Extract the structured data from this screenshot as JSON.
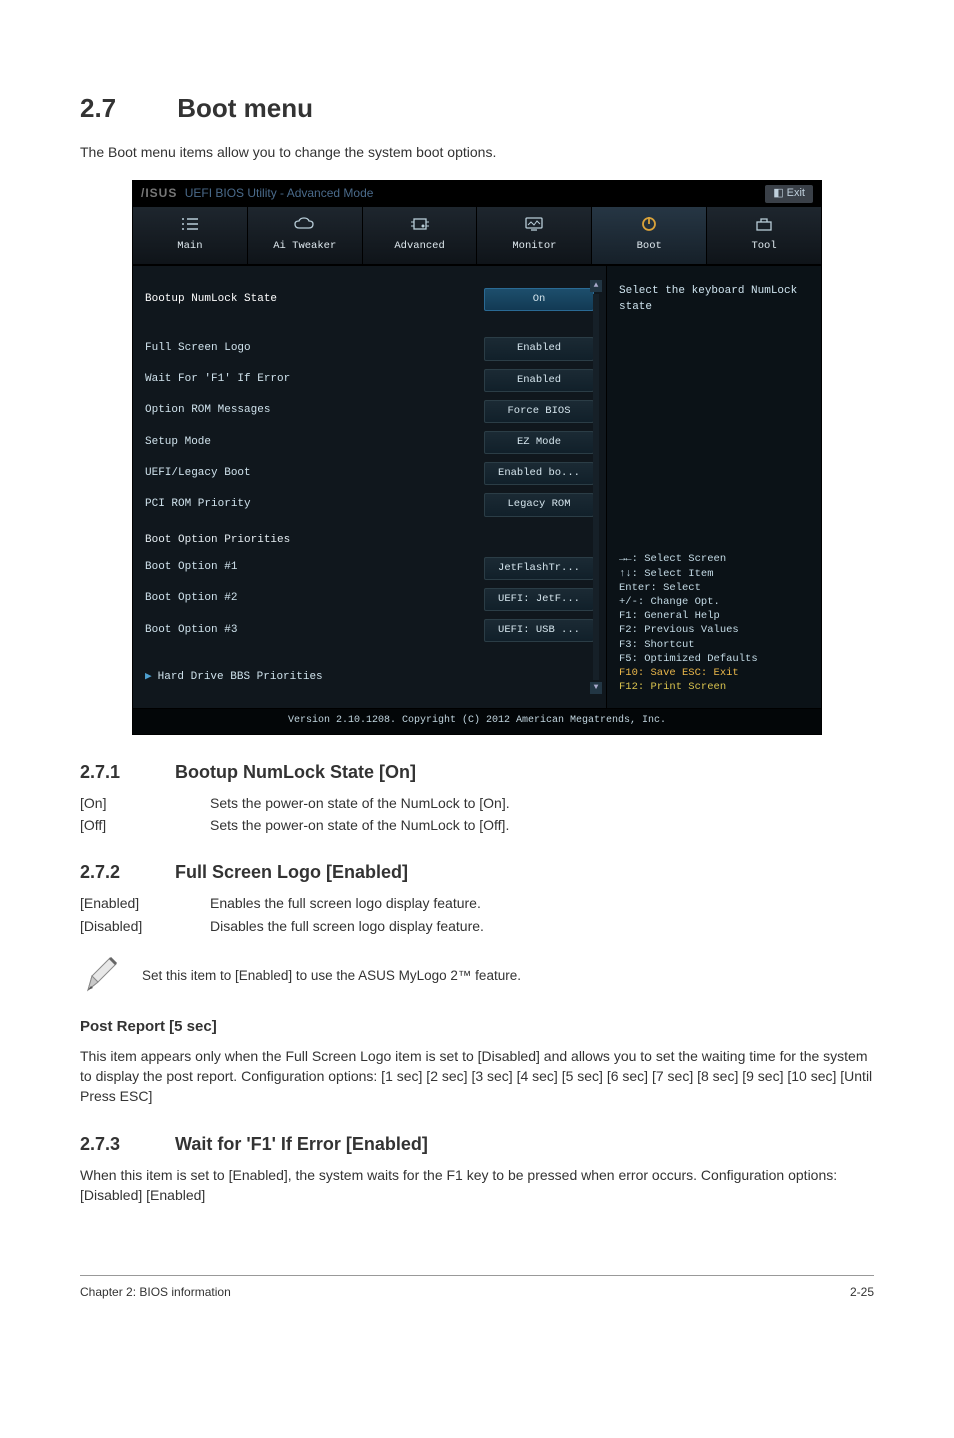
{
  "section27": {
    "num": "2.7",
    "title": "Boot menu"
  },
  "intro27": "The Boot menu items allow you to change the system boot options.",
  "bios": {
    "brand": "/ISUS",
    "titlebar": "UEFI BIOS Utility - Advanced Mode",
    "exit": "Exit",
    "tabs": {
      "main": "Main",
      "ai": "Ai Tweaker",
      "adv": "Advanced",
      "mon": "Monitor",
      "boot": "Boot",
      "tool": "Tool"
    },
    "fields": {
      "numlock": {
        "label": "Bootup NumLock State",
        "value": "On"
      },
      "logo": {
        "label": "Full Screen Logo",
        "value": "Enabled"
      },
      "waitf1": {
        "label": "Wait For 'F1' If Error",
        "value": "Enabled"
      },
      "oprom": {
        "label": "Option ROM Messages",
        "value": "Force BIOS"
      },
      "setup": {
        "label": "Setup Mode",
        "value": "EZ Mode"
      },
      "uefileg": {
        "label": "UEFI/Legacy Boot",
        "value": "Enabled bo..."
      },
      "pcirom": {
        "label": "PCI ROM Priority",
        "value": "Legacy ROM"
      }
    },
    "bootpri_title": "Boot Option Priorities",
    "bootopts": {
      "o1": {
        "label": "Boot Option #1",
        "value": "JetFlashTr..."
      },
      "o2": {
        "label": "Boot Option #2",
        "value": "UEFI: JetF..."
      },
      "o3": {
        "label": "Boot Option #3",
        "value": "UEFI: USB ..."
      }
    },
    "hdd_line": "Hard Drive BBS Priorities",
    "rhelp": "Select the keyboard NumLock state",
    "keys": {
      "l1": "→←: Select Screen",
      "l2": "↑↓: Select Item",
      "l3": "Enter: Select",
      "l4": "+/-: Change Opt.",
      "l5": "F1: General Help",
      "l6": "F2: Previous Values",
      "l7": "F3: Shortcut",
      "l8": "F5: Optimized Defaults",
      "l9": "F10: Save  ESC: Exit",
      "l10": "F12: Print Screen"
    },
    "footer": "Version 2.10.1208. Copyright (C) 2012 American Megatrends, Inc."
  },
  "s271": {
    "num": "2.7.1",
    "title": "Bootup NumLock State [On]",
    "on_k": "[On]",
    "on_v": "Sets the power-on state of the NumLock to [On].",
    "off_k": "[Off]",
    "off_v": "Sets the power-on state of the NumLock to [Off]."
  },
  "s272": {
    "num": "2.7.2",
    "title": "Full Screen Logo [Enabled]",
    "en_k": "[Enabled]",
    "en_v": "Enables the full screen logo display feature.",
    "dis_k": "[Disabled]",
    "dis_v": "Disables the full screen logo display feature."
  },
  "note272": "Set this item to [Enabled] to use the ASUS MyLogo 2™ feature.",
  "post": {
    "title": "Post Report [5 sec]",
    "body": "This item appears only when the Full Screen Logo item is set to [Disabled] and allows you to set the waiting time for the system to display the post report. Configuration options: [1 sec] [2 sec] [3 sec] [4 sec] [5 sec] [6 sec] [7 sec] [8 sec] [9 sec] [10 sec] [Until Press ESC]"
  },
  "s273": {
    "num": "2.7.3",
    "title": "Wait for 'F1' If Error [Enabled]",
    "body": "When this item is set to [Enabled], the system waits for the F1 key to be pressed when error occurs. Configuration options: [Disabled] [Enabled]"
  },
  "footer": {
    "left": "Chapter 2: BIOS information",
    "right": "2-25"
  }
}
